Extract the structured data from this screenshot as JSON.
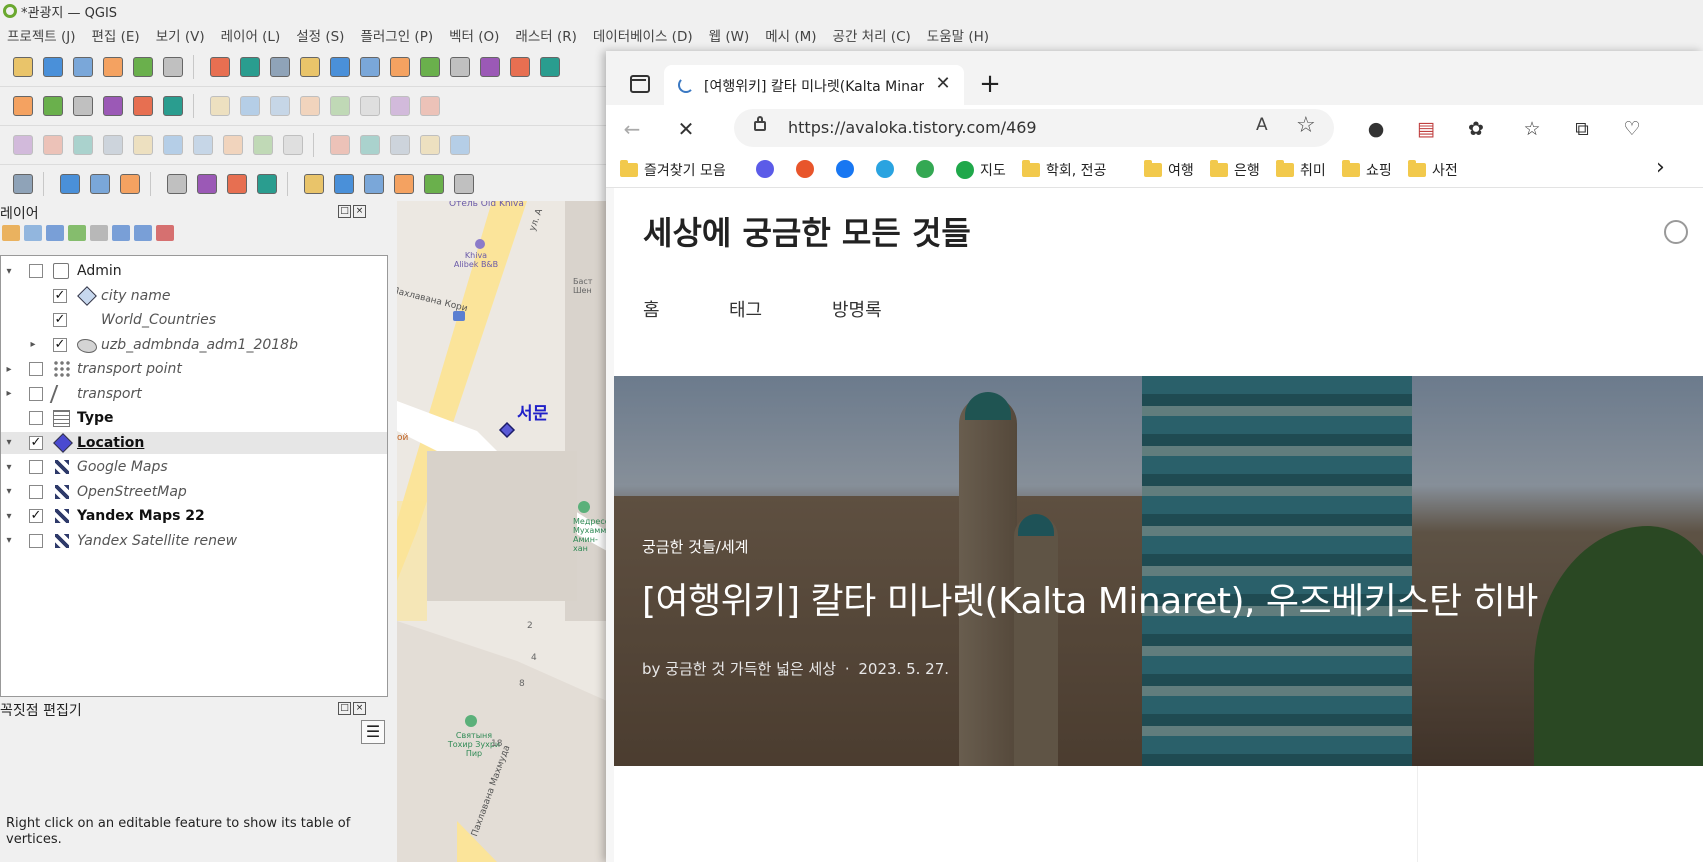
{
  "qgis": {
    "title": "*관광지 — QGIS",
    "menu": [
      "프로젝트 (J)",
      "편집 (E)",
      "보기 (V)",
      "레이어 (L)",
      "설정 (S)",
      "플러그인 (P)",
      "벡터 (O)",
      "래스터 (R)",
      "데이터베이스 (D)",
      "웹 (W)",
      "메시 (M)",
      "공간 처리 (C)",
      "도움말 (H)"
    ],
    "layers_panel_title": "레이어",
    "layers": [
      {
        "name": "Admin",
        "checked": false,
        "style": "normal",
        "icon": "group-icon"
      },
      {
        "name": "city name",
        "checked": true,
        "style": "italic",
        "icon": "point-diamond-icon"
      },
      {
        "name": "World_Countries",
        "checked": true,
        "style": "italic",
        "icon": "empty-icon"
      },
      {
        "name": "uzb_admbnda_adm1_2018b",
        "checked": true,
        "style": "italic",
        "icon": "polygon-icon"
      },
      {
        "name": "transport point",
        "checked": false,
        "style": "italic",
        "icon": "point-layer-icon"
      },
      {
        "name": "transport",
        "checked": false,
        "style": "italic",
        "icon": "line-layer-icon"
      },
      {
        "name": "Type",
        "checked": false,
        "style": "bold",
        "icon": "table-icon"
      },
      {
        "name": "Location",
        "checked": true,
        "style": "bold-underline",
        "icon": "point-diamond-icon"
      },
      {
        "name": "Google Maps",
        "checked": false,
        "style": "italic",
        "icon": "xyz-tile-icon"
      },
      {
        "name": "OpenStreetMap",
        "checked": false,
        "style": "italic",
        "icon": "xyz-tile-icon"
      },
      {
        "name": "Yandex Maps 22",
        "checked": true,
        "style": "bold",
        "icon": "xyz-tile-icon"
      },
      {
        "name": "Yandex Satellite renew",
        "checked": false,
        "style": "italic",
        "icon": "xyz-tile-icon"
      }
    ],
    "vertex_panel_title": "꼭짓점 편집기",
    "vertex_hint": "Right click on an editable feature to show its table of vertices.",
    "map_labels": {
      "hotel_top": "Отель Old Khiva",
      "street_top": "ул. А",
      "poi_khiva": "Khiva Alibek B&B",
      "poi_bast": "Баст Шен",
      "street_kori": "Пахлавана Кори",
      "location_label": "서문",
      "poi_madrasa": "Медресе Мухаммад Амин-хан",
      "poi_tomb": "Святыня Тохир Зуxри Пир",
      "street_bottom": "Пахлавана Махмуда",
      "house_2": "2",
      "house_4": "4",
      "house_8": "8",
      "house_18": "18",
      "poi_left": "ой"
    }
  },
  "browser": {
    "tab_title": "[여행위키] 칼타 미나렛(Kalta Minaret), 우즈베키스탄 히바",
    "url": "https://avaloka.tistory.com/469",
    "read_aloud": "A)",
    "favorites": [
      {
        "label": "즐겨찾기 모음",
        "type": "folder"
      },
      {
        "label": "",
        "type": "site",
        "color": "#5b5be8",
        "icon": "dict-icon"
      },
      {
        "label": "",
        "type": "site",
        "color": "#e8552b",
        "icon": "brand-icon"
      },
      {
        "label": "",
        "type": "site",
        "color": "#1877f2",
        "icon": "facebook-icon"
      },
      {
        "label": "",
        "type": "site",
        "color": "#2aa3e0",
        "icon": "telegram-icon"
      },
      {
        "label": "",
        "type": "site",
        "color": "#34a853",
        "icon": "google-maps-icon"
      },
      {
        "label": "지도",
        "type": "site",
        "color": "#1fa84a",
        "icon": "map-site-icon"
      },
      {
        "label": "학회, 전공",
        "type": "folder"
      },
      {
        "label": "여행",
        "type": "folder"
      },
      {
        "label": "은행",
        "type": "folder"
      },
      {
        "label": "취미",
        "type": "folder"
      },
      {
        "label": "쇼핑",
        "type": "folder"
      },
      {
        "label": "사전",
        "type": "folder"
      }
    ],
    "page": {
      "blog_title": "세상에 궁금한 모든 것들",
      "nav": [
        "홈",
        "태그",
        "방명록"
      ],
      "hero_category": "궁금한 것들/세계",
      "hero_title": "[여행위키] 칼타 미나렛(Kalta Minaret), 우즈베키스탄 히바",
      "hero_author": "by 궁금한 것 가득한 넓은 세상",
      "hero_dot": "·",
      "hero_date": "2023. 5. 27."
    }
  },
  "colors": {
    "accent": "#3a78c2",
    "qgis_green": "#6aa82f",
    "folder": "#f2c94c"
  }
}
